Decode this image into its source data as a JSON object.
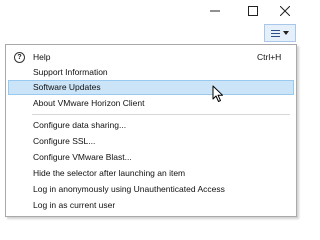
{
  "window": {
    "controls": [
      "minimize-icon",
      "maximize-icon",
      "close-icon"
    ]
  },
  "toolbar": {
    "menu_icon": "hamburger-menu-icon",
    "caret_icon": "chevron-down-icon"
  },
  "menu": {
    "help": {
      "label": "Help",
      "shortcut": "Ctrl+H",
      "icon": "help-icon"
    },
    "support": {
      "label": "Support Information"
    },
    "updates": {
      "label": "Software Updates"
    },
    "about": {
      "label": "About VMware Horizon Client"
    },
    "data_sharing": {
      "label": "Configure data sharing..."
    },
    "ssl": {
      "label": "Configure SSL..."
    },
    "blast": {
      "label": "Configure VMware Blast..."
    },
    "hide_selector": {
      "label": "Hide the selector after launching an item"
    },
    "anonymous": {
      "label": "Log in anonymously using Unauthenticated Access"
    },
    "current_user": {
      "label": "Log in as current user"
    }
  },
  "colors": {
    "highlight_bg": "#cce4f7",
    "highlight_border": "#99c9ef",
    "menu_button_bg": "#e6f0fb"
  }
}
